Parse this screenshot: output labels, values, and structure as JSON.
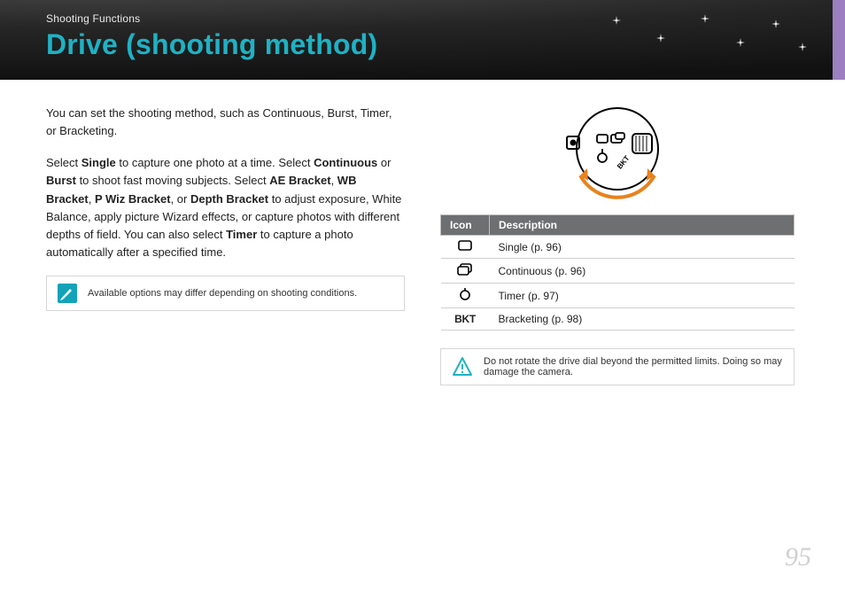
{
  "header": {
    "breadcrumb": "Shooting Functions",
    "title": "Drive (shooting method)"
  },
  "left": {
    "p1": "You can set the shooting method, such as Continuous, Burst, Timer, or Bracketing.",
    "p2_parts": {
      "a": "Select ",
      "b": "Single",
      "c": " to capture one photo at a time. Select ",
      "d": "Continuous",
      "e": " or ",
      "f": "Burst",
      "g": " to shoot fast moving subjects. Select ",
      "h": "AE Bracket",
      "i": ", ",
      "j": "WB Bracket",
      "k": ", ",
      "l": "P Wiz Bracket",
      "m": ", or ",
      "n": "Depth Bracket",
      "o": " to adjust exposure, White Balance, apply picture Wizard effects, or capture photos with different depths of field. You can also select ",
      "p": "Timer",
      "q": " to capture a photo automatically after a specified time."
    },
    "note": "Available options may differ depending on shooting conditions."
  },
  "table": {
    "headers": {
      "icon": "Icon",
      "desc": "Description"
    },
    "rows": [
      {
        "icon": "single-icon",
        "desc": "Single (p. 96)"
      },
      {
        "icon": "continuous-icon",
        "desc": "Continuous (p. 96)"
      },
      {
        "icon": "timer-icon",
        "desc": "Timer (p. 97)"
      },
      {
        "icon": "bkt-icon",
        "label": "BKT",
        "desc": "Bracketing (p. 98)"
      }
    ],
    "warning": "Do not rotate the drive dial beyond the permitted limits. Doing so may damage the camera."
  },
  "page_number": "95"
}
